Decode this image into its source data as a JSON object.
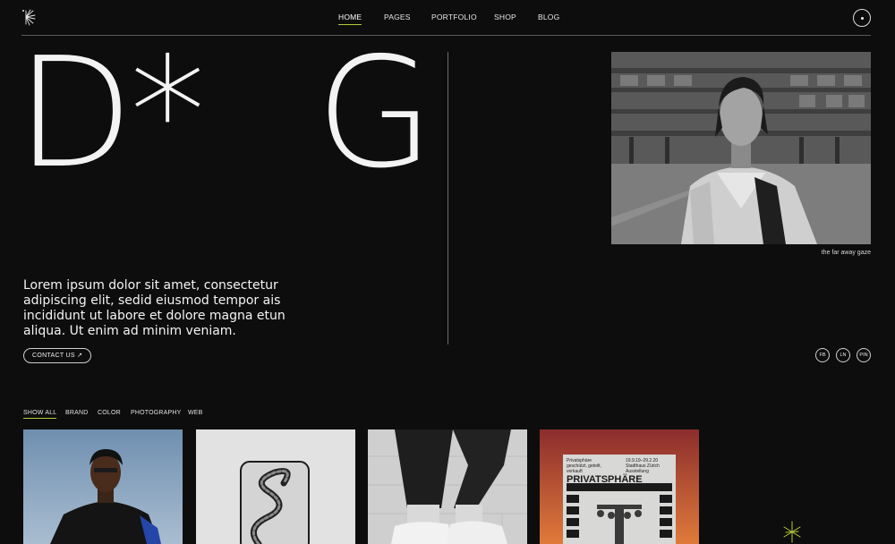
{
  "nav": {
    "items": [
      {
        "label": "HOME",
        "active": true
      },
      {
        "label": "PAGES",
        "active": false
      },
      {
        "label": "PORTFOLIO",
        "active": false
      },
      {
        "label": "SHOP",
        "active": false
      },
      {
        "label": "BLOG",
        "active": false
      }
    ]
  },
  "hero": {
    "letter_left": "D*",
    "letter_right": "G",
    "intro": "Lorem ipsum dolor sit amet, consectetur adipiscing elit, sedid eiusmod tempor ais incididunt ut labore et dolore magna etun aliqua. Ut enim ad minim veniam.",
    "contact_label": "CONTACT US ↗",
    "photo_caption": "the far away gaze"
  },
  "social": [
    "FB",
    "LN",
    "PIN"
  ],
  "filters": [
    {
      "label": "SHOW ALL",
      "active": true
    },
    {
      "label": "BRAND",
      "active": false
    },
    {
      "label": "COLOR",
      "active": false
    },
    {
      "label": "PHOTOGRAPHY",
      "active": false
    },
    {
      "label": "WEB",
      "active": false
    }
  ],
  "poster": {
    "text_left": "Privatsphäre geschützt, geteilt, verkauft",
    "text_right": "19.9.19–29.2.20 Stadthaus Zürich Ausstellung",
    "headline": "PRIVATSPHÄRE"
  },
  "colors": {
    "background": "#0d0d0d",
    "accent": "#b5c93a",
    "text": "#f1f1f1"
  },
  "icons": [
    "burst-logo-icon",
    "menu-dot-icon",
    "sparkle-icon"
  ]
}
